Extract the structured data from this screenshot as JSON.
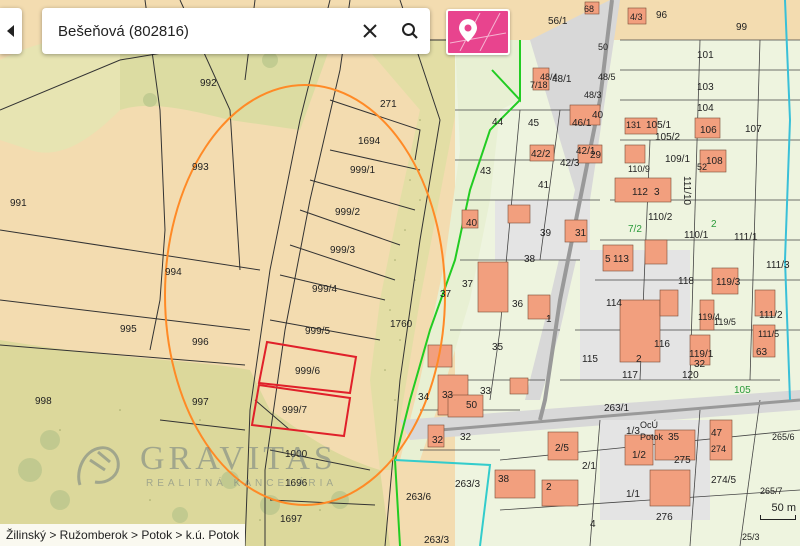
{
  "search": {
    "query": "Bešeňová (802816)"
  },
  "icons": {
    "side_toggle": "triangle-left-icon",
    "clear": "close-icon",
    "search": "search-icon",
    "layers": "map-pin-layer-icon"
  },
  "colors": {
    "accent": "#e8448e",
    "parcel_highlight": "#e0202a",
    "circle": "#ff8a26",
    "boundary_green": "#22cc22",
    "boundary_cyan": "#33cccc",
    "building": "#f29f7e"
  },
  "breadcrumb": {
    "text": "Žilinský > Ružomberok > Potok > k.ú. Potok"
  },
  "scale": {
    "label": "50 m"
  },
  "watermark": {
    "name": "GRAVITAS",
    "tagline": "REALITNÁ KANCELÁRIA"
  },
  "parcels": {
    "p992": "992",
    "p993": "993",
    "p991": "991",
    "p994": "994",
    "p995": "995",
    "p996": "996",
    "p997": "997",
    "p998": "998",
    "p1000": "1000",
    "p1696": "1696",
    "p1697": "1697",
    "p271": "271",
    "p1694": "1694",
    "p999_1": "999/1",
    "p999_2": "999/2",
    "p999_3": "999/3",
    "p999_4": "999/4",
    "p999_5": "999/5",
    "p999_6": "999/6",
    "p999_7": "999/7",
    "p1760": "1760",
    "p44": "44",
    "p45": "45",
    "p43": "43",
    "p41": "41",
    "p40": "40",
    "p39": "39",
    "p31": "31",
    "p38": "38",
    "p37": "37",
    "p37b": "37",
    "p36": "36",
    "p1": "1",
    "p35": "35",
    "p34": "34",
    "p33": "33",
    "p33b": "33",
    "p50": "50",
    "p32": "32",
    "p32b": "32",
    "p263_6": "263/6",
    "p263_3": "263/3",
    "p263_3b": "263/3",
    "p38b": "38",
    "p2": "2",
    "p2_5": "2/5",
    "p2_1": "2/1",
    "p4": "4",
    "p1_1": "1/1",
    "p276": "276",
    "p56_1": "56/1",
    "p68": "68",
    "p96": "96",
    "p4_3": "4/3",
    "p99": "99",
    "p101": "101",
    "p103": "103",
    "p104": "104",
    "p107": "107",
    "p48_1": "48/1",
    "p48_5": "48/5",
    "p48_3": "48/3",
    "p50b": "50",
    "p7_18": "7/18",
    "p48_4": "48/4",
    "p40b": "40",
    "p46_1": "46/1",
    "p131": "131",
    "p105_1": "105/1",
    "p105_2": "105/2",
    "p106": "106",
    "p42_2": "42/2",
    "p42_1": "42/1",
    "p42_3": "42/3",
    "p29": "29",
    "p109_1": "109/1",
    "p108": "108",
    "p52": "52",
    "p110_9": "110/9",
    "p112": "112",
    "p3": "3",
    "p110_2": "110/2",
    "p110_1": "110/1",
    "p111_1": "111/1",
    "p111_10": "111/10",
    "p111_3": "111/3",
    "p7_2": "7/2",
    "p2b": "2",
    "p5": "5",
    "p113": "113",
    "p114": "114",
    "p118": "118",
    "p119_3": "119/3",
    "p119_4": "119/4",
    "p119_5": "119/5",
    "p111_2": "111/2",
    "p111_5": "111/5",
    "p63": "63",
    "p116": "116",
    "p115": "115",
    "p2c": "2",
    "p119_1": "119/1",
    "p32c": "32",
    "p120": "120",
    "p117": "117",
    "p105": "105",
    "p263_1": "263/1",
    "p1_3": "1/3",
    "p1_2": "1/2",
    "p35b": "35",
    "p47": "47",
    "p274": "274",
    "p275": "275",
    "p274_5": "274/5",
    "p265_6": "265/6",
    "p265_7": "265/7",
    "p25_3": "25/3",
    "ocu": "OcÚ",
    "potok": "Potok"
  }
}
